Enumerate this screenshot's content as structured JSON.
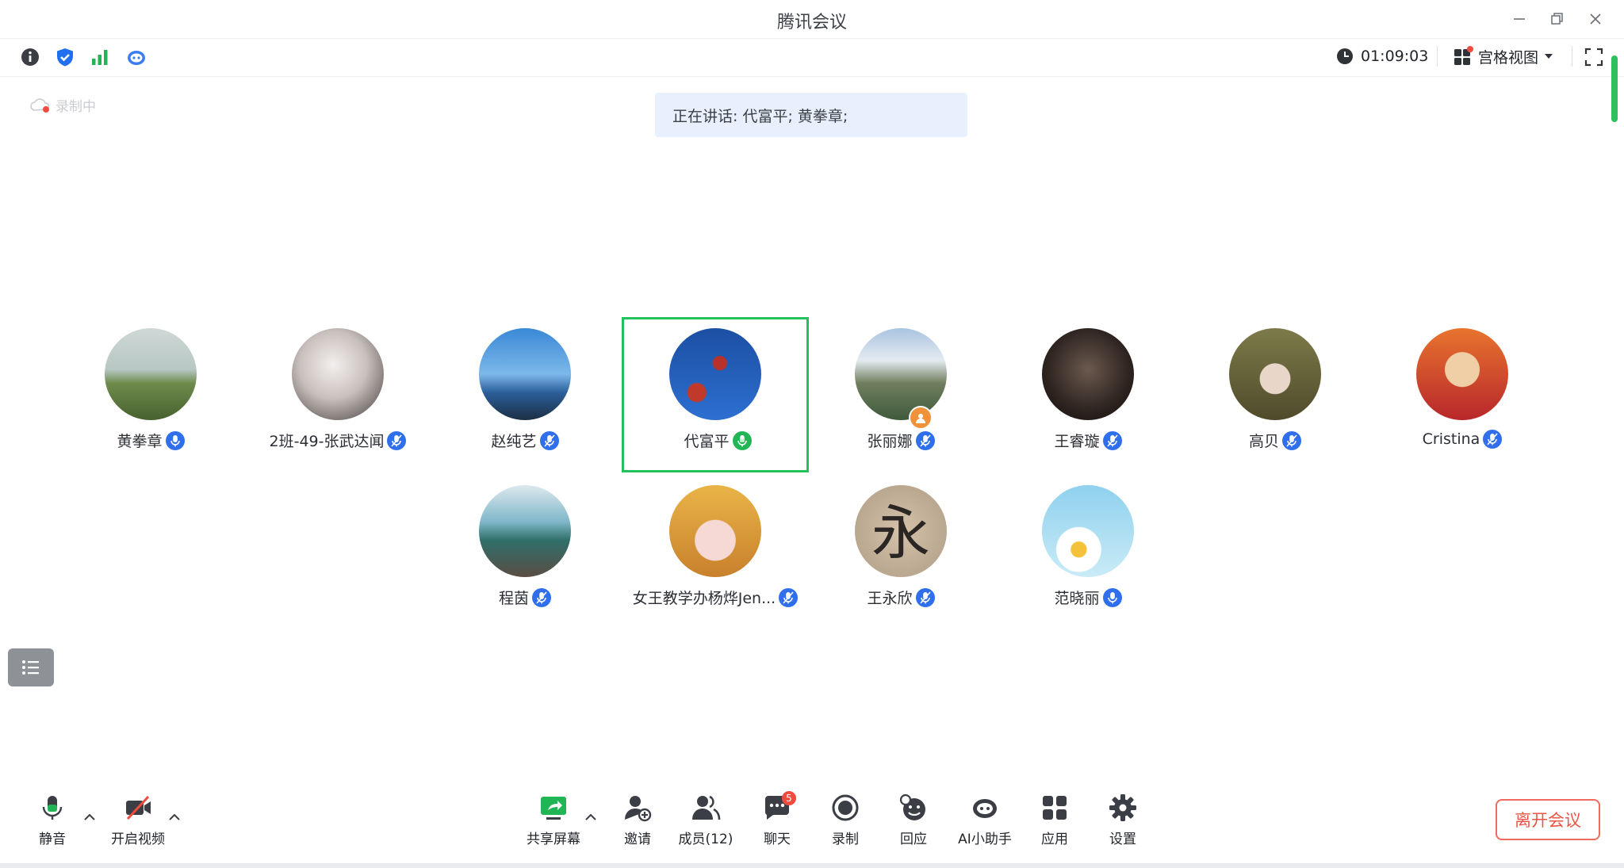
{
  "window": {
    "title": "腾讯会议",
    "controls": [
      "minimize-icon",
      "restore-icon",
      "close-icon"
    ]
  },
  "topbar": {
    "icons": [
      "info-icon",
      "shield-check-icon",
      "signal-bars-icon",
      "assistant-icon"
    ],
    "timer": "01:09:03",
    "view_mode": "宫格视图"
  },
  "recording_label": "录制中",
  "speaking_banner": "正在讲话: 代富平; 黄拳章;",
  "participants": [
    {
      "name": "黄拳章",
      "mic": "on"
    },
    {
      "name": "2班-49-张武达闻",
      "mic": "muted"
    },
    {
      "name": "赵纯艺",
      "mic": "muted"
    },
    {
      "name": "代富平",
      "mic": "speaking",
      "active": true
    },
    {
      "name": "张丽娜",
      "mic": "muted"
    },
    {
      "name": "王睿璇",
      "mic": "muted"
    },
    {
      "name": "高贝",
      "mic": "muted"
    },
    {
      "name": "Cristina",
      "mic": "muted"
    },
    {
      "name": "程茵",
      "mic": "muted"
    },
    {
      "name": "女王教学办杨烨Jen...",
      "mic": "muted"
    },
    {
      "name": "王永欣",
      "mic": "muted"
    },
    {
      "name": "范晓丽",
      "mic": "on"
    }
  ],
  "toolbar": {
    "mute": "静音",
    "video": "开启视频",
    "share": "共享屏幕",
    "invite": "邀请",
    "members": "成员(12)",
    "chat": "聊天",
    "chat_badge": "5",
    "record": "录制",
    "reaction": "回应",
    "ai": "AI小助手",
    "apps": "应用",
    "settings": "设置",
    "leave": "离开会议"
  },
  "colors": {
    "accent_green": "#23c15a",
    "mic_blue": "#2f6fec",
    "leave_red": "#ec5446",
    "banner_bg": "#e8f0fd"
  }
}
